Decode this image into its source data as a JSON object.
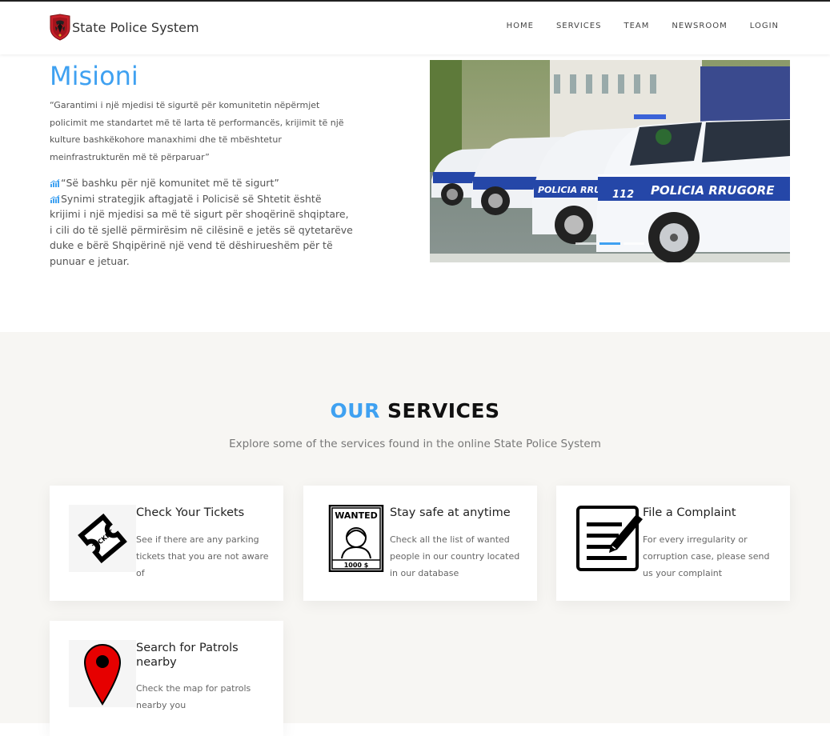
{
  "brand": {
    "name": "State Police System"
  },
  "nav": [
    "HOME",
    "SERVICES",
    "TEAM",
    "NEWSROOM",
    "LOGIN"
  ],
  "mission": {
    "title": "Misioni",
    "quote": "“Garantimi i një mjedisi të sigurtë për komunitetin nëpërmjet policimit me standartet më të larta të performancës, krijimit të një kulture bashkëkohore manaxhimi dhe të mbështetur meinfrastrukturën më të përparuar”",
    "motto": "“Së bashku për një komunitet më të sigurt”",
    "vision": "Synimi strategjik aftagjatë i Policisë së Shtetit është krijimi i një mjedisi sa më të sigurt për shoqërinë shqiptare, i cili do të sjellë përmirësim në cilësinë e jetës së qytetarëve duke e bërë Shqipërinë një vend të dëshirueshëm për të punuar e jetuar."
  },
  "carousel": {
    "car_text": "POLICIA RRUGORE",
    "car_number": "112",
    "slides": 3,
    "active_slide": 2
  },
  "services": {
    "title_accent": "OUR",
    "title_rest": "SERVICES",
    "subtitle": "Explore some of the services found in the online State Police System",
    "cards": [
      {
        "icon": "ticket-icon",
        "ticket_text": "TICKET",
        "title": "Check Your Tickets",
        "desc": "See if there are any parking tickets that you are not aware of"
      },
      {
        "icon": "wanted-poster-icon",
        "wanted_text": "WANTED",
        "reward_text": "1000 $",
        "title": "Stay safe at anytime",
        "desc": "Check all the list of wanted people in our country located in our database"
      },
      {
        "icon": "complaint-form-icon",
        "title": "File a Complaint",
        "desc": "For every irregularity or corruption case, please send us your complaint"
      },
      {
        "icon": "map-pin-icon",
        "title": "Search for Patrols nearby",
        "desc": "Check the map for patrols nearby you"
      }
    ]
  },
  "colors": {
    "accent": "#3fa1f1",
    "section_bg": "#f7f6f3",
    "police_blue": "#2547a8"
  }
}
